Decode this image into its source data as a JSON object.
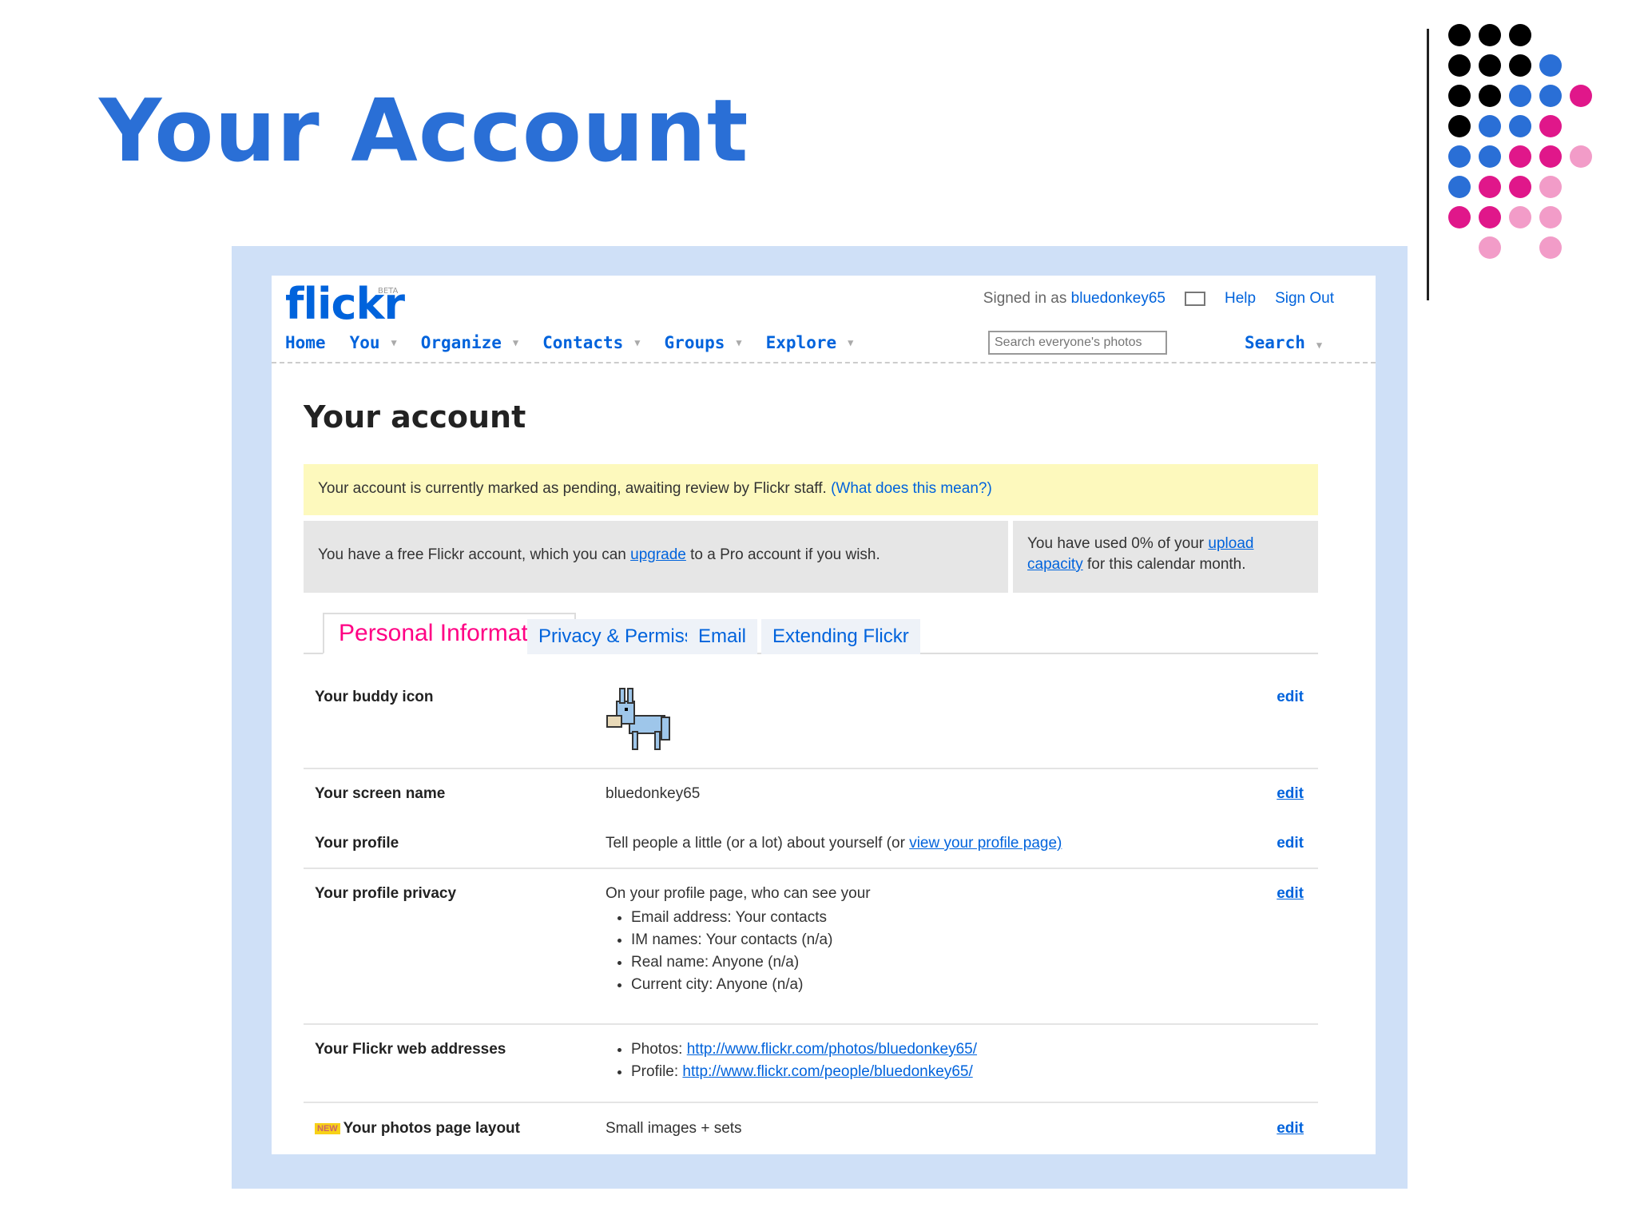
{
  "slide": {
    "title": "Your Account"
  },
  "dots": {
    "colors": {
      "black": "#000000",
      "blue": "#2a6fd6",
      "magenta": "#e0178a",
      "pink": "#f29cc8"
    }
  },
  "flickr": {
    "logo": "flickr",
    "logo_beta": "BETA",
    "signed_in_prefix": "Signed in as",
    "username": "bluedonkey65",
    "help": "Help",
    "sign_out": "Sign Out",
    "nav": [
      "Home",
      "You",
      "Organize",
      "Contacts",
      "Groups",
      "Explore"
    ],
    "search_placeholder": "Search everyone's photos",
    "search_button": "Search"
  },
  "page": {
    "heading": "Your account",
    "notice_text": "Your account is currently marked as pending, awaiting review by Flickr staff.",
    "notice_link": "(What does this mean?)",
    "free_text_1": "You have a free Flickr account, which you can",
    "free_link": "upgrade",
    "free_text_2": "to a Pro account if you wish.",
    "usage_text": "You have used 0% of your",
    "usage_link": "upload capacity",
    "usage_text_2": "for this calendar month."
  },
  "tabs": [
    {
      "label": "Personal Information",
      "active": true
    },
    {
      "label": "Privacy & Permissions",
      "active": false
    },
    {
      "label": "Email",
      "active": false
    },
    {
      "label": "Extending Flickr",
      "active": false
    }
  ],
  "rows": {
    "buddy_icon": {
      "label": "Your buddy icon",
      "edit": "edit"
    },
    "screen_name": {
      "label": "Your screen name",
      "value": "bluedonkey65",
      "edit": "edit"
    },
    "profile": {
      "label": "Your profile",
      "value": "Tell people a little (or a lot) about yourself (or",
      "link": "view your profile page)",
      "edit": "edit"
    },
    "privacy": {
      "label": "Your profile privacy",
      "value": "On your profile page, who can see your",
      "items": [
        "Email address: Your contacts",
        "IM names: Your contacts (n/a)",
        "Real name: Anyone (n/a)",
        "Current city: Anyone (n/a)"
      ],
      "edit": "edit"
    },
    "web": {
      "label": "Your Flickr web addresses",
      "photos_label": "Photos:",
      "photos_url": "http://www.flickr.com/photos/bluedonkey65/",
      "profile_label": "Profile:",
      "profile_url": "http://www.flickr.com/people/bluedonkey65/"
    },
    "layout": {
      "badge": "NEW",
      "label": "Your photos page layout",
      "value": "Small images + sets",
      "edit": "edit"
    }
  }
}
